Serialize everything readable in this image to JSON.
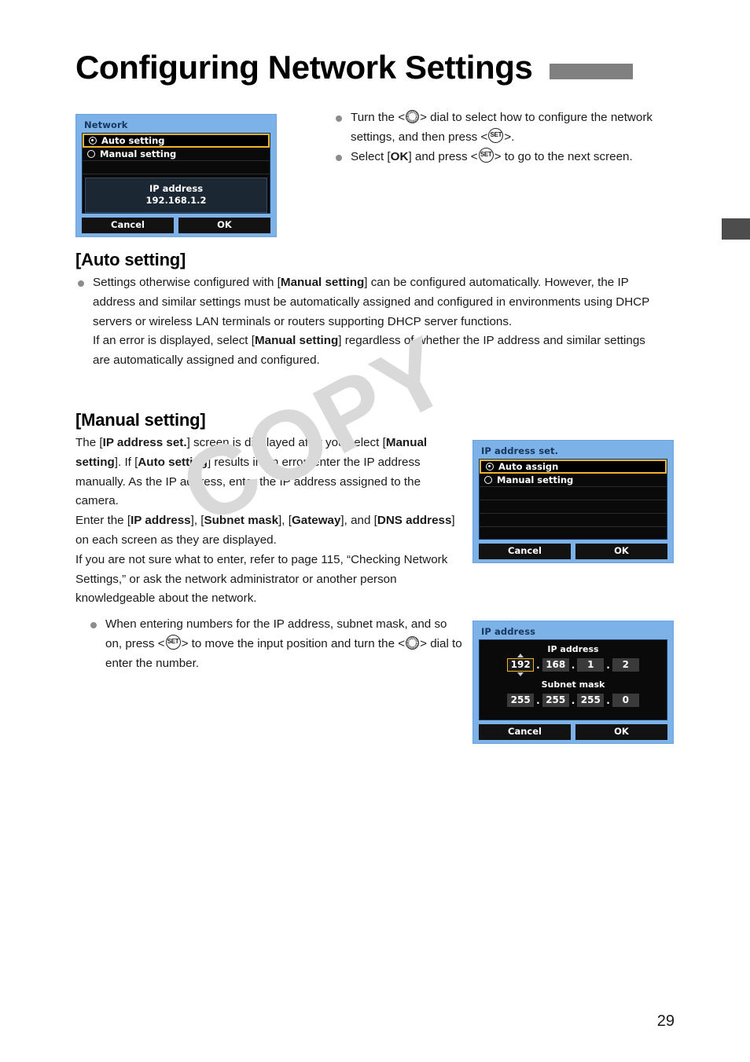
{
  "page": {
    "title": "Configuring Network Settings",
    "number": "29"
  },
  "watermark": {
    "text": "COPY"
  },
  "intro_bullets": [
    {
      "parts": [
        {
          "t": "Turn the <"
        },
        {
          "icon": "dial-icon"
        },
        {
          "t": "> dial to select how to configure the network settings, and then press <"
        },
        {
          "icon": "set-icon"
        },
        {
          "t": ">."
        }
      ]
    },
    {
      "parts": [
        {
          "t": "Select ["
        },
        {
          "t": "OK",
          "b": true
        },
        {
          "t": "] and press <"
        },
        {
          "icon": "set-icon"
        },
        {
          "t": "> to go to the next screen."
        }
      ]
    }
  ],
  "auto_section": {
    "heading": "[Auto setting]",
    "bullet": {
      "paragraphs": [
        [
          {
            "t": "Settings otherwise configured with ["
          },
          {
            "t": "Manual setting",
            "b": true
          },
          {
            "t": "] can be configured automatically. However, the IP address and similar settings must be automatically assigned and configured in environments using DHCP servers or wireless LAN terminals or routers supporting DHCP server functions."
          }
        ],
        [
          {
            "t": "If an error is displayed, select ["
          },
          {
            "t": "Manual setting",
            "b": true
          },
          {
            "t": "] regardless of whether the IP address and similar settings are automatically assigned and configured."
          }
        ]
      ]
    }
  },
  "manual_section": {
    "heading": "[Manual setting]",
    "paragraphs": [
      [
        {
          "t": "The ["
        },
        {
          "t": "IP address set.",
          "b": true
        },
        {
          "t": "] screen is displayed after you select ["
        },
        {
          "t": "Manual setting",
          "b": true
        },
        {
          "t": "]. If ["
        },
        {
          "t": "Auto setting",
          "b": true
        },
        {
          "t": "] results in an error, enter the IP address manually. As the IP address, enter the IP address assigned to the camera."
        }
      ],
      [
        {
          "t": "Enter the ["
        },
        {
          "t": "IP address",
          "b": true
        },
        {
          "t": "], ["
        },
        {
          "t": "Subnet mask",
          "b": true
        },
        {
          "t": "], ["
        },
        {
          "t": "Gateway",
          "b": true
        },
        {
          "t": "], and ["
        },
        {
          "t": "DNS address",
          "b": true
        },
        {
          "t": "] on each screen as they are displayed."
        }
      ],
      [
        {
          "t": "If you are not sure what to enter, refer to page 115, “Checking Network Settings,” or ask the network administrator or another person knowledgeable about the network."
        }
      ]
    ],
    "bullet": {
      "parts": [
        {
          "t": "When entering numbers for the IP address, subnet mask, and so on, press <"
        },
        {
          "icon": "set-icon"
        },
        {
          "t": "> to move the input position and turn the <"
        },
        {
          "icon": "dial-icon"
        },
        {
          "t": "> dial to enter the number."
        }
      ]
    }
  },
  "screens": {
    "network": {
      "title": "Network",
      "options": [
        {
          "label": "Auto setting",
          "selected": true,
          "checked": true
        },
        {
          "label": "Manual setting",
          "selected": false,
          "checked": false
        }
      ],
      "panel": {
        "label": "IP address",
        "value": "192.168.1.2"
      },
      "buttons": {
        "cancel": "Cancel",
        "ok": "OK"
      }
    },
    "ip_address_set": {
      "title": "IP address set.",
      "options": [
        {
          "label": "Auto assign",
          "selected": true,
          "checked": true
        },
        {
          "label": "Manual setting",
          "selected": false,
          "checked": false
        }
      ],
      "buttons": {
        "cancel": "Cancel",
        "ok": "OK"
      }
    },
    "ip_address": {
      "title": "IP address",
      "groups": [
        {
          "label": "IP address",
          "octets": [
            "192",
            "168",
            "1",
            "2"
          ],
          "active_index": 0
        },
        {
          "label": "Subnet mask",
          "octets": [
            "255",
            "255",
            "255",
            "0"
          ],
          "active_index": -1
        }
      ],
      "buttons": {
        "cancel": "Cancel",
        "ok": "OK"
      }
    }
  },
  "colors": {
    "lcd_blue": "#7db2e8",
    "highlight_yellow": "#f0b429",
    "marker_gray": "#808080",
    "tab_gray": "#4d4d4d",
    "watermark_gray": "#d9d9d9"
  }
}
